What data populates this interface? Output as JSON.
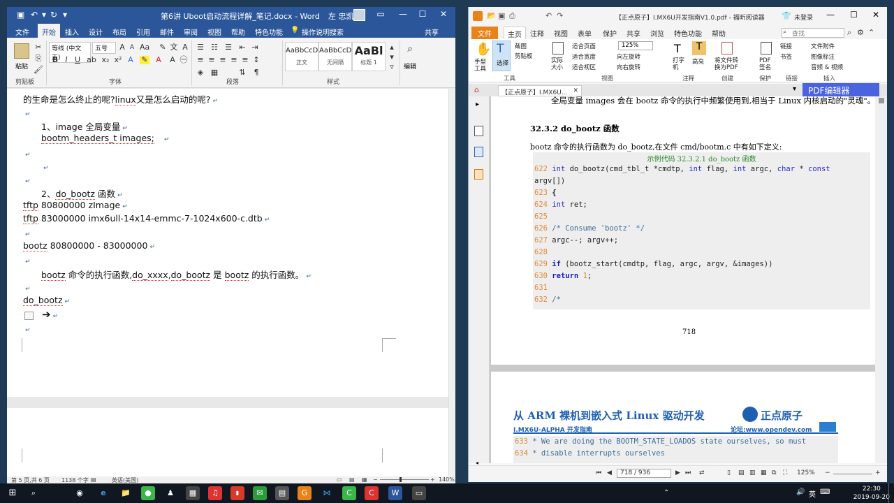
{
  "word": {
    "title": "第6讲 Uboot启动流程详解_笔记.docx - Word",
    "user": "左 忠凯",
    "tabs": [
      "文件",
      "开始",
      "插入",
      "设计",
      "布局",
      "引用",
      "邮件",
      "审阅",
      "视图",
      "帮助",
      "特色功能",
      "操作说明搜索"
    ],
    "active_tab": "开始",
    "share": "共享",
    "font_name": "等线 (中文正)",
    "font_size": "五号",
    "paste": "粘贴",
    "edit": "编辑",
    "groups": [
      "剪贴板",
      "字体",
      "段落",
      "样式"
    ],
    "styles": [
      {
        "preview": "AaBbCcDı",
        "name": "正文"
      },
      {
        "preview": "AaBbCcDı",
        "name": "无间隔"
      },
      {
        "preview": "AaBl",
        "name": "标题 1"
      }
    ],
    "doc": {
      "line0_a": "的生命是怎么终止的呢?",
      "line0_b": "linux",
      "line0_c": "又是怎么启动的呢?",
      "item1": "1、image 全局变量",
      "item1_code": "bootm_headers_t images;",
      "item2_a": "2、",
      "item2_b": "do_bootz",
      "item2_c": "函数",
      "tftp1_a": "tftp",
      "tftp1_b": "80800000 zImage",
      "tftp2_a": "tftp",
      "tftp2_b": "83000000 imx6ull-14x14-emmc-7-1024x600-c.dtb",
      "bootz_a": "bootz",
      "bootz_b": "80800000 - 83000000",
      "note_a": "bootz",
      "note_b": "命令的执行函数,",
      "note_c": "do_xxxx",
      "note_d": ",",
      "note_e": "do_bootz",
      "note_f": "是",
      "note_g": "bootz",
      "note_h": "的执行函数。",
      "dobootz": "do_bootz",
      "para_mark": "↵"
    },
    "status": {
      "page": "第 5 页,共 6 页",
      "words": "1138 个字",
      "lang": "英语(美国)",
      "zoom": "140%"
    }
  },
  "foxit": {
    "title": "【正点原子】I.MX6U开发指南V1.0.pdf - 福昕阅读器",
    "login": "未登录",
    "search_placeholder": "查找",
    "tabs": [
      "文件",
      "主页",
      "注释",
      "视图",
      "表单",
      "保护",
      "共享",
      "浏览",
      "特色功能",
      "帮助"
    ],
    "active_tab": "主页",
    "ribbon": {
      "hand": "手型工具",
      "select": "选择",
      "screenshot": "截图",
      "clipboard": "剪贴板",
      "actual": "实际大小",
      "fitpage": "适合页面",
      "fitwidth": "适合宽度",
      "fitview": "适合视区",
      "zoom": "125%",
      "rotl": "向左旋转",
      "rotr": "向右旋转",
      "typewriter": "打字机",
      "highlight": "高亮",
      "topdf": "将文件转换为PDF",
      "sign": "PDF签名",
      "link": "链接",
      "bookmark": "书签",
      "attach": "文件附件",
      "imgannot": "图像标注",
      "media": "音频 & 视频",
      "groups": [
        "工具",
        "视图",
        "注释",
        "创建",
        "保护",
        "链接",
        "插入"
      ]
    },
    "doctab": "【正点原子】I.MX6U...",
    "pdf_edit": "PDF编辑器",
    "page": {
      "top_text": "全局变量 images 会在 bootz 命令的执行中频繁使用到,相当于 Linux 内核启动的\"灵魂\"。",
      "heading": "32.3.2 do_bootz 函数",
      "intro": "bootz 命令的执行函数为 do_bootz,在文件 cmd/bootm.c 中有如下定义:",
      "code_title": "示例代码 32.3.2.1 do_bootz 函数",
      "code_lines": [
        {
          "n": "622",
          "t": "int do_bootz(cmd_tbl_t *cmdtp, int flag, int argc, char * const"
        },
        {
          "n": "",
          "t": "argv[])"
        },
        {
          "n": "623",
          "t": "{"
        },
        {
          "n": "624",
          "t": "    int ret;"
        },
        {
          "n": "625",
          "t": ""
        },
        {
          "n": "626",
          "t": "    /* Consume 'bootz' */"
        },
        {
          "n": "627",
          "t": "    argc--; argv++;"
        },
        {
          "n": "628",
          "t": ""
        },
        {
          "n": "629",
          "t": "    if (bootz_start(cmdtp, flag, argc, argv, &images))"
        },
        {
          "n": "630",
          "t": "        return 1;"
        },
        {
          "n": "631",
          "t": ""
        },
        {
          "n": "632",
          "t": "    /*"
        }
      ],
      "page_no": "718",
      "banner_title": "从 ARM 裸机到嵌入式 Linux 驱动开发",
      "banner_sub": "I.MX6U-ALPHA 开发指南",
      "brand": "正点原子",
      "forum": "论坛:www.opendev.com",
      "code2": [
        {
          "n": "633",
          "t": "     * We are doing the BOOTM_STATE_LOADOS state ourselves, so must"
        },
        {
          "n": "634",
          "t": "     * disable interrupts ourselves"
        }
      ]
    },
    "status": {
      "page_field": "718 / 936",
      "zoom": "125%"
    }
  },
  "taskbar": {
    "time": "22:30",
    "date": "2019-09-20",
    "ime": "英"
  }
}
